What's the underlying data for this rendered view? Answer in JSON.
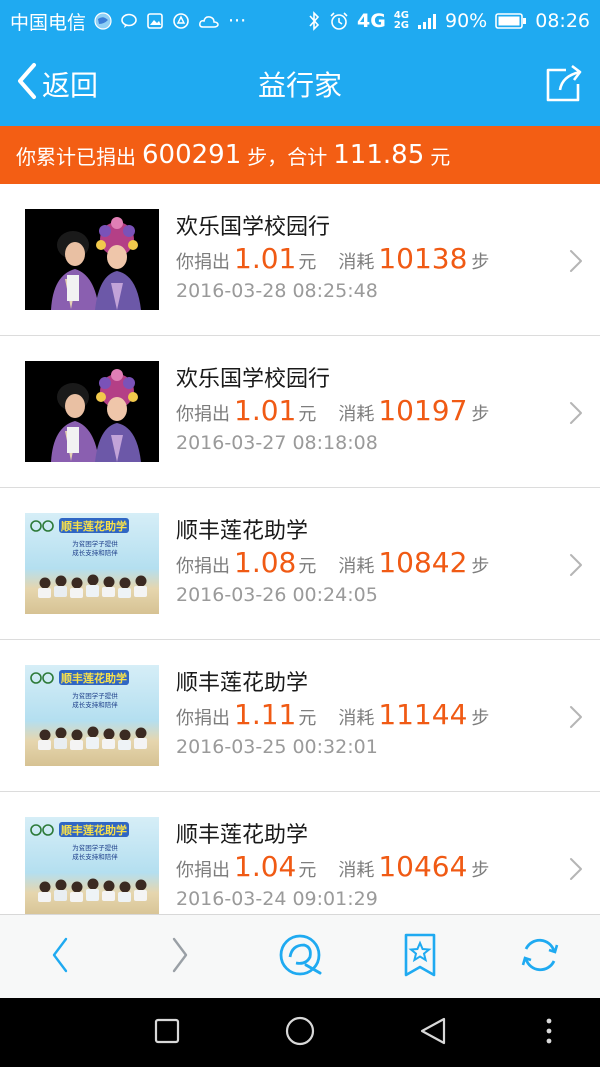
{
  "status_bar": {
    "carrier": "中国电信",
    "network_4g": "4G",
    "network_small_top": "4G",
    "network_small_bottom": "2G",
    "battery": "90%",
    "time": "08:26"
  },
  "nav": {
    "back_label": "返回",
    "title": "益行家"
  },
  "banner": {
    "prefix": "你累计已捐出",
    "total_steps": "600291",
    "middle": "步，合计",
    "total_amount": "111.85",
    "suffix": "元"
  },
  "labels": {
    "you_donated": "你捐出",
    "yuan": "元",
    "consumed": "消耗",
    "steps_unit": "步"
  },
  "records": [
    {
      "title": "欢乐国学校园行",
      "amount": "1.01",
      "steps": "10138",
      "date": "2016-03-28 08:25:48",
      "thumb": "dark"
    },
    {
      "title": "欢乐国学校园行",
      "amount": "1.01",
      "steps": "10197",
      "date": "2016-03-27 08:18:08",
      "thumb": "dark"
    },
    {
      "title": "顺丰莲花助学",
      "amount": "1.08",
      "steps": "10842",
      "date": "2016-03-26 00:24:05",
      "thumb": "sea"
    },
    {
      "title": "顺丰莲花助学",
      "amount": "1.11",
      "steps": "11144",
      "date": "2016-03-25 00:32:01",
      "thumb": "sea"
    },
    {
      "title": "顺丰莲花助学",
      "amount": "1.04",
      "steps": "10464",
      "date": "2016-03-24 09:01:29",
      "thumb": "sea"
    }
  ],
  "thumb_sea_text": {
    "headline": "顺丰莲花助学",
    "line1": "为贫困学子提供",
    "line2": "成长支持和陪伴"
  },
  "colors": {
    "primary_blue": "#1faaf1",
    "banner_orange": "#f35e14",
    "value_orange": "#f05a14"
  },
  "icons": {
    "nav_back": "chevron-left-icon",
    "nav_share": "share-icon",
    "toolbar": [
      "back-arrow-icon",
      "forward-arrow-icon",
      "qq-browser-icon",
      "bookmark-star-icon",
      "refresh-icon"
    ],
    "system": [
      "recent-apps-icon",
      "home-icon",
      "back-icon",
      "menu-dots-icon"
    ]
  }
}
